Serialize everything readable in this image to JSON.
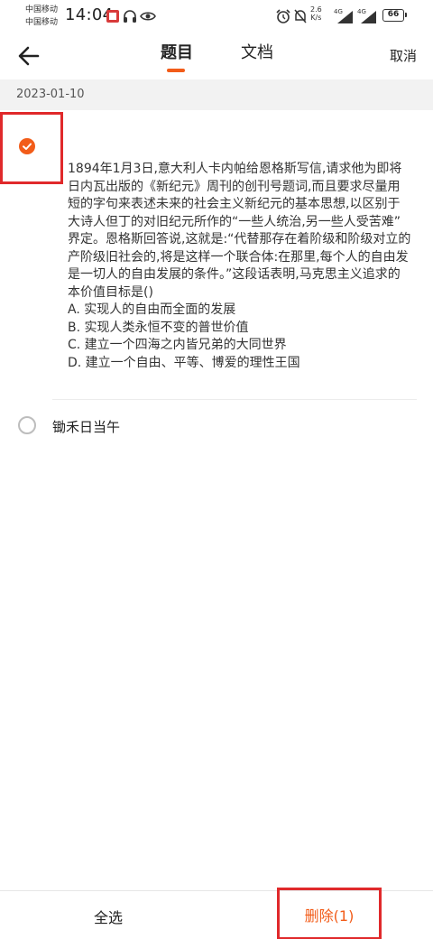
{
  "status_bar": {
    "carrier_1": "中国移动",
    "carrier_2": "中国移动",
    "time": "14:04",
    "net_speed_value": "2.6",
    "net_speed_unit": "K/s",
    "sim1_label": "4G",
    "sim2_label": "4G",
    "battery": "66"
  },
  "header": {
    "tabs": [
      {
        "label": "题目",
        "active": true
      },
      {
        "label": "文档",
        "active": false
      }
    ],
    "cancel_label": "取消",
    "accent_color": "#f25c19"
  },
  "date_group": {
    "date": "2023-01-10"
  },
  "items": [
    {
      "selected": true,
      "question_lines": [
        "1894年1月3日,意大利人卡内帕给恩格斯写信,请求他为即将",
        "日内瓦出版的《新纪元》周刊的创刊号题词,而且要求尽量用",
        "短的字句来表述未来的社会主义新纪元的基本思想,以区别于",
        "大诗人但丁的对旧纪元所作的“一些人统治,另一些人受苦难”",
        "界定。恩格斯回答说,这就是:“代替那存在着阶级和阶级对立的",
        "产阶级旧社会的,将是这样一个联合体:在那里,每个人的自由发",
        "是一切人的自由发展的条件。”这段话表明,马克思主义追求的",
        "本价值目标是()",
        "A. 实现人的自由而全面的发展",
        "B. 实现人类永恒不变的普世价值",
        "C. 建立一个四海之内皆兄弟的大同世界",
        "D. 建立一个自由、平等、博爱的理性王国"
      ]
    },
    {
      "selected": false,
      "title": "锄禾日当午"
    }
  ],
  "bottom_bar": {
    "select_all_label": "全选",
    "delete_label": "删除(1)",
    "highlight_color": "#e0292b"
  }
}
